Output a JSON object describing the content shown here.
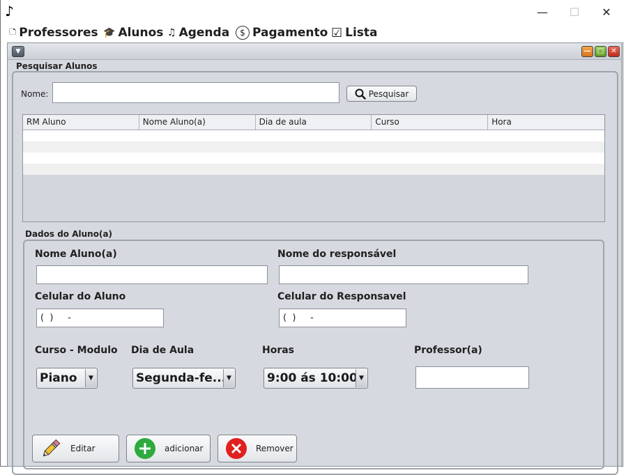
{
  "window": {
    "app_icon": "♪",
    "controls": {
      "minimize": "—",
      "maximize": "☐",
      "close": "✕"
    }
  },
  "menubar": {
    "items": [
      {
        "label": "Professores",
        "icon": "teacher-icon",
        "glyph": "🗅"
      },
      {
        "label": "Alunos",
        "icon": "graduation-cap-icon",
        "glyph": "🎓"
      },
      {
        "label": "Agenda",
        "icon": "music-note-icon",
        "glyph": "♫"
      },
      {
        "label": "Pagamento",
        "icon": "payment-icon",
        "glyph": "$"
      },
      {
        "label": "Lista",
        "icon": "checklist-icon",
        "glyph": "☑"
      }
    ]
  },
  "internal_frame": {
    "system_menu_glyph": "▼",
    "buttons": {
      "minimize": "—",
      "maximize": "□",
      "close": "✕"
    }
  },
  "search": {
    "group_title": "Pesquisar Alunos",
    "name_label": "Nome:",
    "name_value": "",
    "button_label": "Pesquisar"
  },
  "table": {
    "columns": [
      "RM Aluno",
      "Nome Aluno(a)",
      "Dia de aula",
      "Curso",
      "Hora"
    ],
    "rows": [
      [
        "",
        "",
        "",
        "",
        ""
      ],
      [
        "",
        "",
        "",
        "",
        ""
      ],
      [
        "",
        "",
        "",
        "",
        ""
      ],
      [
        "",
        "",
        "",
        "",
        ""
      ]
    ]
  },
  "form": {
    "group_title": "Dados do Aluno(a)",
    "student_name_label": "Nome Aluno(a)",
    "student_name_value": "",
    "guardian_name_label": "Nome do responsável",
    "guardian_name_value": "",
    "student_phone_label": "Celular do Aluno",
    "student_phone_value": "(  )     -",
    "guardian_phone_label": "Celular do Responsavel",
    "guardian_phone_value": "(  )     -",
    "course_label": "Curso - Modulo",
    "course_value": "Piano",
    "day_label": "Dia de Aula",
    "day_value": "Segunda-fe...",
    "hours_label": "Horas",
    "hours_value": "9:00 ás 10:00",
    "teacher_label": "Professor(a)",
    "teacher_value": ""
  },
  "actions": {
    "edit": "Editar",
    "add": "adicionar",
    "remove": "Remover"
  },
  "colors": {
    "frame_bg": "#d6d9df",
    "add_icon": "#2eaa3f",
    "remove_icon": "#e02020",
    "pencil": "#e8b830"
  }
}
